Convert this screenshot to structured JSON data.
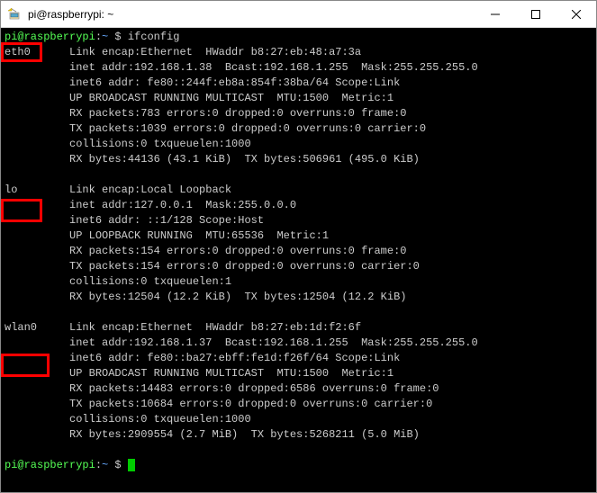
{
  "window": {
    "title": "pi@raspberrypi: ~"
  },
  "prompt": {
    "userhost": "pi@raspberrypi",
    "sep": ":",
    "path": "~",
    "dollar": " $ "
  },
  "command": "ifconfig",
  "ifaces": {
    "eth0": {
      "name": "eth0",
      "lines": [
        "Link encap:Ethernet  HWaddr b8:27:eb:48:a7:3a",
        "inet addr:192.168.1.38  Bcast:192.168.1.255  Mask:255.255.255.0",
        "inet6 addr: fe80::244f:eb8a:854f:38ba/64 Scope:Link",
        "UP BROADCAST RUNNING MULTICAST  MTU:1500  Metric:1",
        "RX packets:783 errors:0 dropped:0 overruns:0 frame:0",
        "TX packets:1039 errors:0 dropped:0 overruns:0 carrier:0",
        "collisions:0 txqueuelen:1000",
        "RX bytes:44136 (43.1 KiB)  TX bytes:506961 (495.0 KiB)"
      ]
    },
    "lo": {
      "name": "lo",
      "lines": [
        "Link encap:Local Loopback",
        "inet addr:127.0.0.1  Mask:255.0.0.0",
        "inet6 addr: ::1/128 Scope:Host",
        "UP LOOPBACK RUNNING  MTU:65536  Metric:1",
        "RX packets:154 errors:0 dropped:0 overruns:0 frame:0",
        "TX packets:154 errors:0 dropped:0 overruns:0 carrier:0",
        "collisions:0 txqueuelen:1",
        "RX bytes:12504 (12.2 KiB)  TX bytes:12504 (12.2 KiB)"
      ]
    },
    "wlan0": {
      "name": "wlan0",
      "lines": [
        "Link encap:Ethernet  HWaddr b8:27:eb:1d:f2:6f",
        "inet addr:192.168.1.37  Bcast:192.168.1.255  Mask:255.255.255.0",
        "inet6 addr: fe80::ba27:ebff:fe1d:f26f/64 Scope:Link",
        "UP BROADCAST RUNNING MULTICAST  MTU:1500  Metric:1",
        "RX packets:14483 errors:0 dropped:6586 overruns:0 frame:0",
        "TX packets:10684 errors:0 dropped:0 overruns:0 carrier:0",
        "collisions:0 txqueuelen:1000",
        "RX bytes:2909554 (2.7 MiB)  TX bytes:5268211 (5.0 MiB)"
      ]
    }
  }
}
